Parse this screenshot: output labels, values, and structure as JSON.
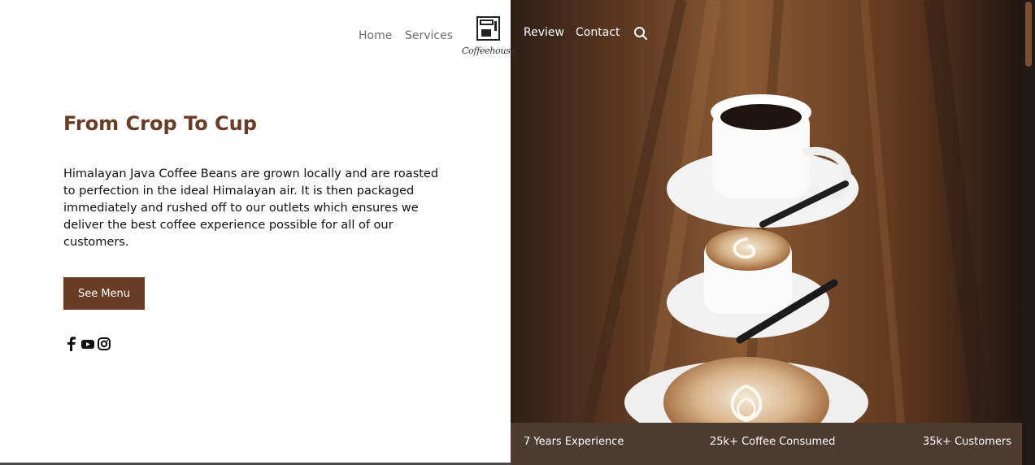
{
  "nav": {
    "home": "Home",
    "services": "Services",
    "review": "Review",
    "contact": "Contact"
  },
  "brand": {
    "name": "Coffeehouse"
  },
  "hero": {
    "title": "From Crop To Cup",
    "description": "Himalayan Java Coffee Beans are grown locally and are roasted to perfection in the ideal Himalayan air. It is then packaged immediately and rushed off to our outlets which ensures we deliver the best coffee experience possible for all of our customers.",
    "button_label": "See Menu"
  },
  "social": {
    "icons": [
      "facebook-icon",
      "youtube-icon",
      "instagram-icon"
    ]
  },
  "stats": {
    "experience": "7 Years Experience",
    "consumed": "25k+ Coffee Consumed",
    "customers": "35k+ Customers"
  },
  "colors": {
    "accent": "#6a3c26",
    "stats_bar": "#4d3b2f",
    "wood": "#6a4126"
  }
}
